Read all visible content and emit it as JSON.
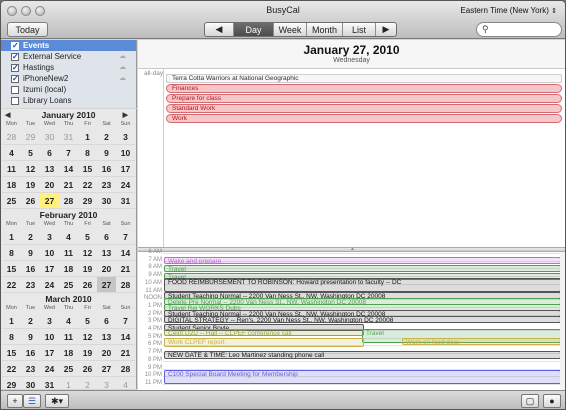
{
  "app_title": "BusyCal",
  "timezone": "Eastern Time (New York)",
  "toolbar": {
    "today": "Today",
    "prev": "◀",
    "next": "▶",
    "views": [
      "Day",
      "Week",
      "Month",
      "List"
    ],
    "active_view": "Day",
    "search_icon": "search-icon"
  },
  "calendars": [
    {
      "name": "Events",
      "checked": true,
      "selected": true
    },
    {
      "name": "External Service",
      "checked": true
    },
    {
      "name": "Hastings",
      "checked": true
    },
    {
      "name": "iPhoneNew2",
      "checked": true
    },
    {
      "name": "Izumi (local)",
      "checked": false
    },
    {
      "name": "Library Loans",
      "checked": false
    }
  ],
  "weekday_headers": [
    "Mon",
    "Tue",
    "Wed",
    "Thu",
    "Fri",
    "Sat",
    "Sun"
  ],
  "mini_months": [
    {
      "title": "January 2010",
      "prev": "◀",
      "next": "▶",
      "weeks": [
        [
          "28",
          "29",
          "30",
          "31",
          "1",
          "2",
          "3"
        ],
        [
          "4",
          "5",
          "6",
          "7",
          "8",
          "9",
          "10"
        ],
        [
          "11",
          "12",
          "13",
          "14",
          "15",
          "16",
          "17"
        ],
        [
          "18",
          "19",
          "20",
          "21",
          "22",
          "23",
          "24"
        ],
        [
          "25",
          "26",
          "27",
          "28",
          "29",
          "30",
          "31"
        ]
      ]
    },
    {
      "title": "February 2010",
      "weeks": [
        [
          "1",
          "2",
          "3",
          "4",
          "5",
          "6",
          "7"
        ],
        [
          "8",
          "9",
          "10",
          "11",
          "12",
          "13",
          "14"
        ],
        [
          "15",
          "16",
          "17",
          "18",
          "19",
          "20",
          "21"
        ],
        [
          "22",
          "23",
          "24",
          "25",
          "26",
          "27",
          "28"
        ]
      ]
    },
    {
      "title": "March 2010",
      "weeks": [
        [
          "1",
          "2",
          "3",
          "4",
          "5",
          "6",
          "7"
        ],
        [
          "8",
          "9",
          "10",
          "11",
          "12",
          "13",
          "14"
        ],
        [
          "15",
          "16",
          "17",
          "18",
          "19",
          "20",
          "21"
        ],
        [
          "22",
          "23",
          "24",
          "25",
          "26",
          "27",
          "28"
        ],
        [
          "29",
          "30",
          "31",
          "1",
          "2",
          "3",
          "4"
        ]
      ]
    }
  ],
  "day_header": {
    "date": "January 27, 2010",
    "weekday": "Wednesday"
  },
  "allday_label": "all-day",
  "allday_events": [
    {
      "title": "Terra Cotta Warriors at National Geographic",
      "style": "plain"
    },
    {
      "title": "Finances",
      "style": "red"
    },
    {
      "title": "Prepare for class",
      "style": "red"
    },
    {
      "title": "Standard Work",
      "style": "red"
    },
    {
      "title": "Work",
      "style": "red"
    }
  ],
  "hour_labels": [
    "6 AM",
    "7 AM",
    "8 AM",
    "9 AM",
    "10 AM",
    "11 AM",
    "NOON",
    "1 PM",
    "2 PM",
    "3 PM",
    "4 PM",
    "5 PM",
    "6 PM",
    "7 PM",
    "8 PM",
    "9 PM",
    "10 PM",
    "11 PM"
  ],
  "timed_events": [
    {
      "title": "Wake and prepare",
      "color": "#c06ad9"
    },
    {
      "title": "Travel",
      "color": "#4fa04f"
    },
    {
      "title": "Travel",
      "color": "#4fa04f"
    },
    {
      "title": "FOOD REIMBURSEMENT TO ROBINSON: Howard presentation to faculty -- DC",
      "color": "#555555"
    },
    {
      "title": "Student Teaching Normal -- 2200 Van Ness St., NW, Washington DC 20008",
      "color": "#555555"
    },
    {
      "title": "Delete Pre Normal -- 2200 Van Ness St., NW, Washington DC 20008",
      "color": "#4fa04f"
    },
    {
      "title": "Travel Rei WORKS Dubs",
      "color": "#4fa04f"
    },
    {
      "title": "Student Teaching Normal -- 2200 Van Ness St., NW, Washington DC 20008",
      "color": "#555555"
    },
    {
      "title": "DIGITAL STRATEGY -- Ren's, 2200 Van Ness St., NW, Washington DC 20008",
      "color": "#555555"
    },
    {
      "title": "Student Senior Boyle",
      "color": "#555555"
    },
    {
      "title": "Ceipt D2D -- Hall -- CLPEF conference call",
      "color": "#9aa53a"
    },
    {
      "title": "Travel",
      "color": "#4fa04f"
    },
    {
      "title": "Work CLPEF report",
      "color": "#c9b24a"
    },
    {
      "title": "Work on food docs",
      "color": "#c9b24a"
    },
    {
      "title": "NEW DATE & TIME: Leo Martinez standing phone call",
      "color": "#555555"
    },
    {
      "title": "C100 Special Board Meeting for Membership",
      "color": "#5f5fe0"
    }
  ],
  "bottom": {
    "add": "+",
    "cal_icon": "calendar-list-icon",
    "gear": "✱▾",
    "right1": "sidebar-toggle-icon",
    "right2": "info-icon"
  }
}
